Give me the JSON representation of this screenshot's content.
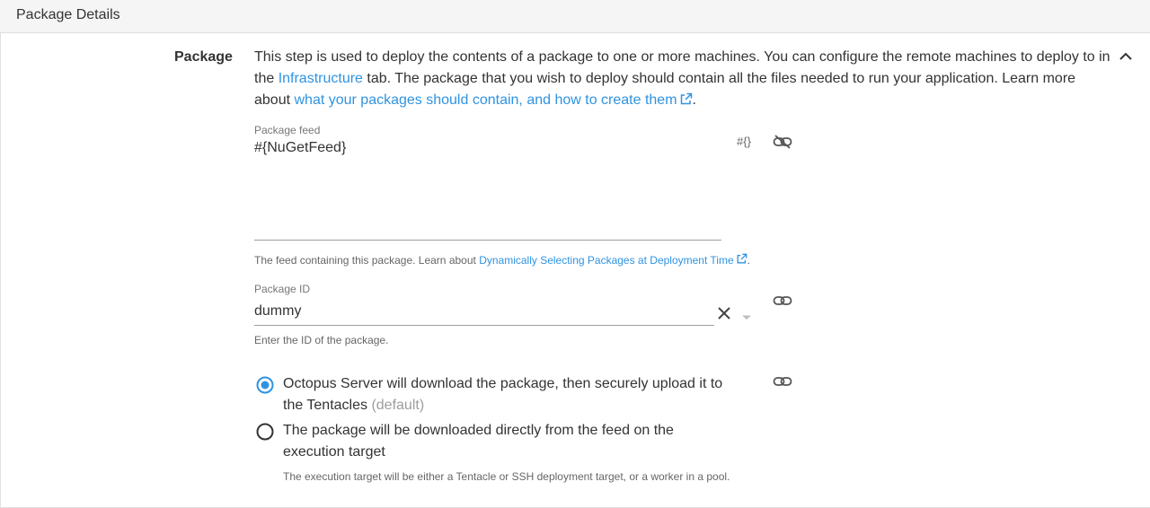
{
  "header": {
    "title": "Package Details"
  },
  "section": {
    "label": "Package",
    "description": {
      "part1": "This step is used to deploy the contents of a package to one or more machines. You can configure the remote machines to deploy to in the ",
      "link1": "Infrastructure",
      "part2": " tab. The package that you wish to deploy should contain all the files needed to run your application. Learn more about ",
      "link2": "what your packages should contain, and how to create them",
      "part3": "."
    }
  },
  "package_feed": {
    "label": "Package feed",
    "value": "#{NuGetFeed}",
    "variable_icon_text": "#{}",
    "helper_prefix": "The feed containing this package. Learn about ",
    "helper_link": "Dynamically Selecting Packages at Deployment Time",
    "helper_suffix": "."
  },
  "package_id": {
    "label": "Package ID",
    "value": "dummy",
    "helper": "Enter the ID of the package."
  },
  "acquisition": {
    "options": [
      {
        "label": "Octopus Server will download the package, then securely upload it to the Tentacles",
        "suffix": "(default)",
        "selected": true
      },
      {
        "label": "The package will be downloaded directly from the feed on the execution target",
        "suffix": "",
        "selected": false
      }
    ],
    "note": "The execution target will be either a Tentacle or SSH deployment target, or a worker in a pool."
  },
  "colors": {
    "accent": "#2f93e0",
    "text": "#333333",
    "muted": "#9e9e9e"
  }
}
